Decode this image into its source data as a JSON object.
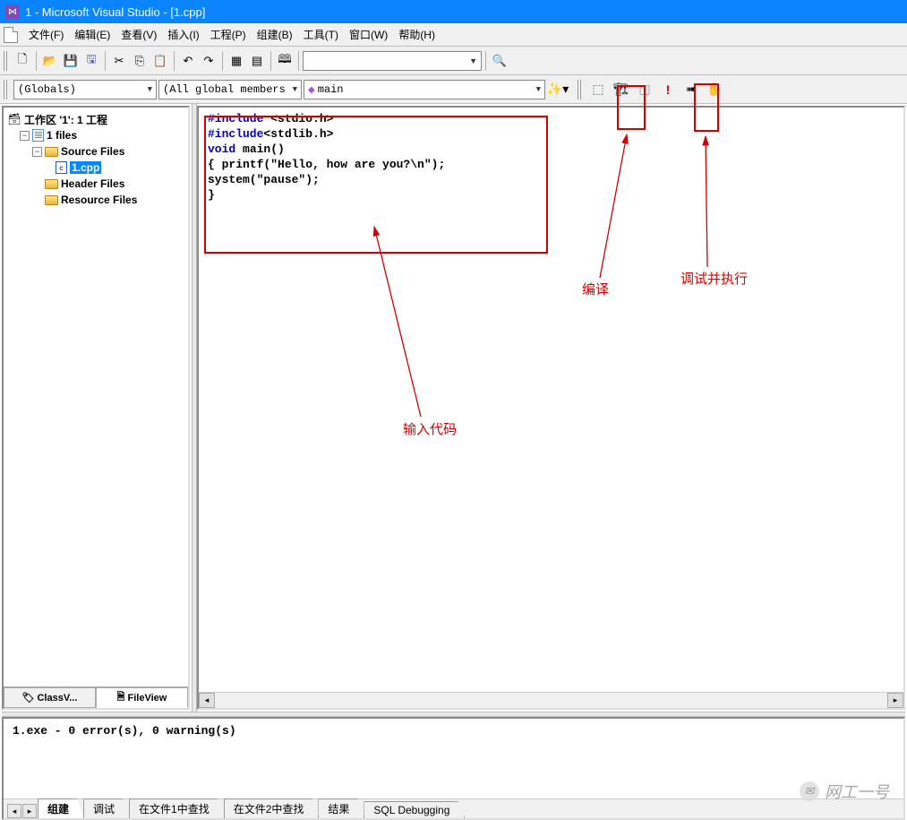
{
  "title": "1 - Microsoft Visual Studio - [1.cpp]",
  "menu": {
    "file": "文件(F)",
    "edit": "编辑(E)",
    "view": "查看(V)",
    "insert": "插入(I)",
    "project": "工程(P)",
    "build": "组建(B)",
    "tools": "工具(T)",
    "window": "窗口(W)",
    "help": "帮助(H)"
  },
  "toolbar": {
    "search_value": ""
  },
  "combo": {
    "globals": "(Globals)",
    "members": "(All global members",
    "func": "main"
  },
  "tree": {
    "workspace": "工作区 '1': 1 工程",
    "project": "1 files",
    "source": "Source Files",
    "file1": "1.cpp",
    "header": "Header Files",
    "resource": "Resource Files"
  },
  "sidebar_tabs": {
    "classview": "ClassV...",
    "fileview": "FileView"
  },
  "code": {
    "l1a": "#include",
    "l1b": " <stdio.h>",
    "l2a": "#include",
    "l2b": "<stdlib.h>",
    "l3a": "void",
    "l3b": " main()",
    "l4": "{ printf(\"Hello, how are you?\\n\");",
    "l5": "system(\"pause\");",
    "l6": "}"
  },
  "annotations": {
    "compile": "编译",
    "debug_run": "调试并执行",
    "input_code": "输入代码"
  },
  "output": {
    "text": "1.exe - 0 error(s), 0 warning(s)",
    "tabs": {
      "build": "组建",
      "debug": "调试",
      "find1": "在文件1中查找",
      "find2": "在文件2中查找",
      "results": "结果",
      "sql": "SQL Debugging"
    }
  },
  "watermark": "网工一号"
}
